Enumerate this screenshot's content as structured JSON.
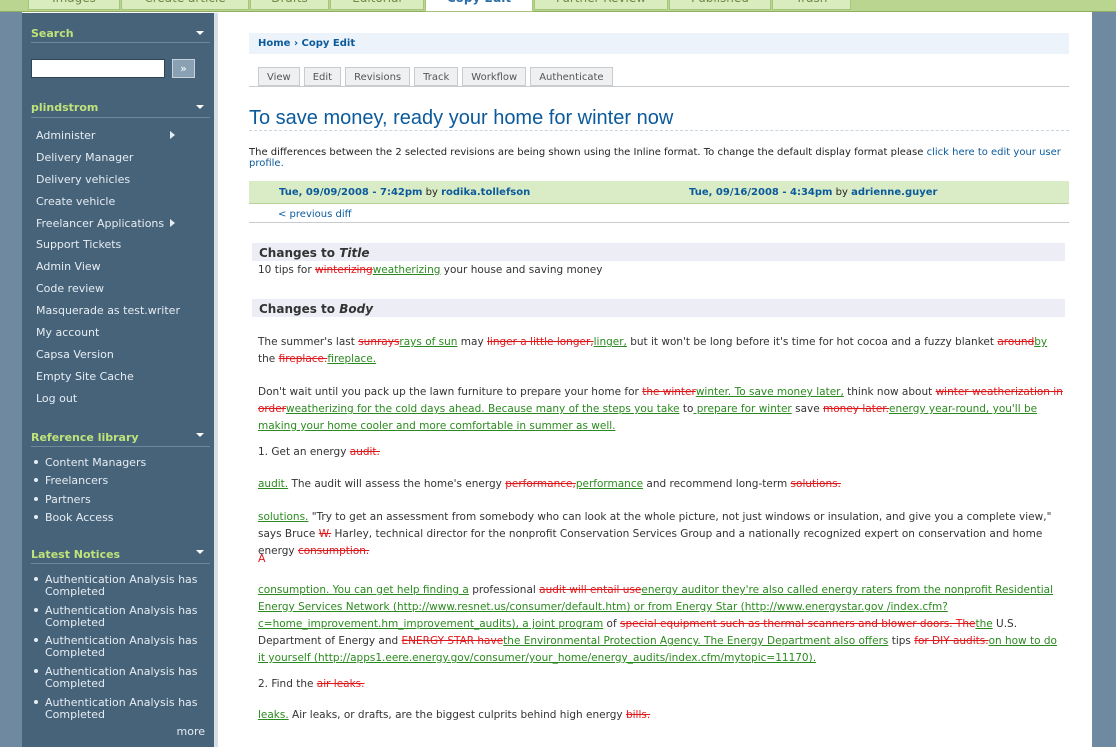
{
  "top_tabs": [
    "Images",
    "Create article",
    "Drafts",
    "Editorial",
    "Copy Edit",
    "Further Review",
    "Published",
    "Trash"
  ],
  "active_tab": "Copy Edit",
  "sidebar": {
    "search_title": "Search",
    "search_button": "»",
    "user_title": "plindstrom",
    "menu": [
      "Administer",
      "Delivery Manager",
      "Delivery vehicles",
      "Create vehicle",
      "Freelancer Applications",
      "Support Tickets",
      "Admin View",
      "Code review",
      "Masquerade as test.writer",
      "My account",
      "Capsa Version",
      "Empty Site Cache",
      "Log out"
    ],
    "ref_title": "Reference library",
    "ref_items": [
      "Content Managers",
      "Freelancers",
      "Partners",
      "Book Access"
    ],
    "notices_title": "Latest Notices",
    "notices": [
      "Authentication Analysis has Completed",
      "Authentication Analysis has Completed",
      "Authentication Analysis has Completed",
      "Authentication Analysis has Completed",
      "Authentication Analysis has Completed"
    ],
    "more": "more"
  },
  "breadcrumb": {
    "home": "Home",
    "sep": "›",
    "current": "Copy Edit"
  },
  "node_tabs": [
    "View",
    "Edit",
    "Revisions",
    "Track",
    "Workflow",
    "Authenticate"
  ],
  "page_title": "To save money, ready your home for winter now",
  "intro": {
    "text": "The differences between the 2 selected revisions are being shown using the Inline format. To change the default display format please ",
    "link": "click here to edit your user profile."
  },
  "revisions": {
    "left_date": "Tue, 09/09/2008 - 7:42pm",
    "by": "by",
    "left_user": "rodika.tollefson",
    "right_date": "Tue, 09/16/2008 - 4:34pm",
    "right_user": "adrienne.guyer",
    "prev": "< previous diff"
  },
  "changes": {
    "title_label": "Changes to",
    "title_field": "Title",
    "body_label": "Changes to",
    "body_field": "Body"
  },
  "red_a": "A"
}
